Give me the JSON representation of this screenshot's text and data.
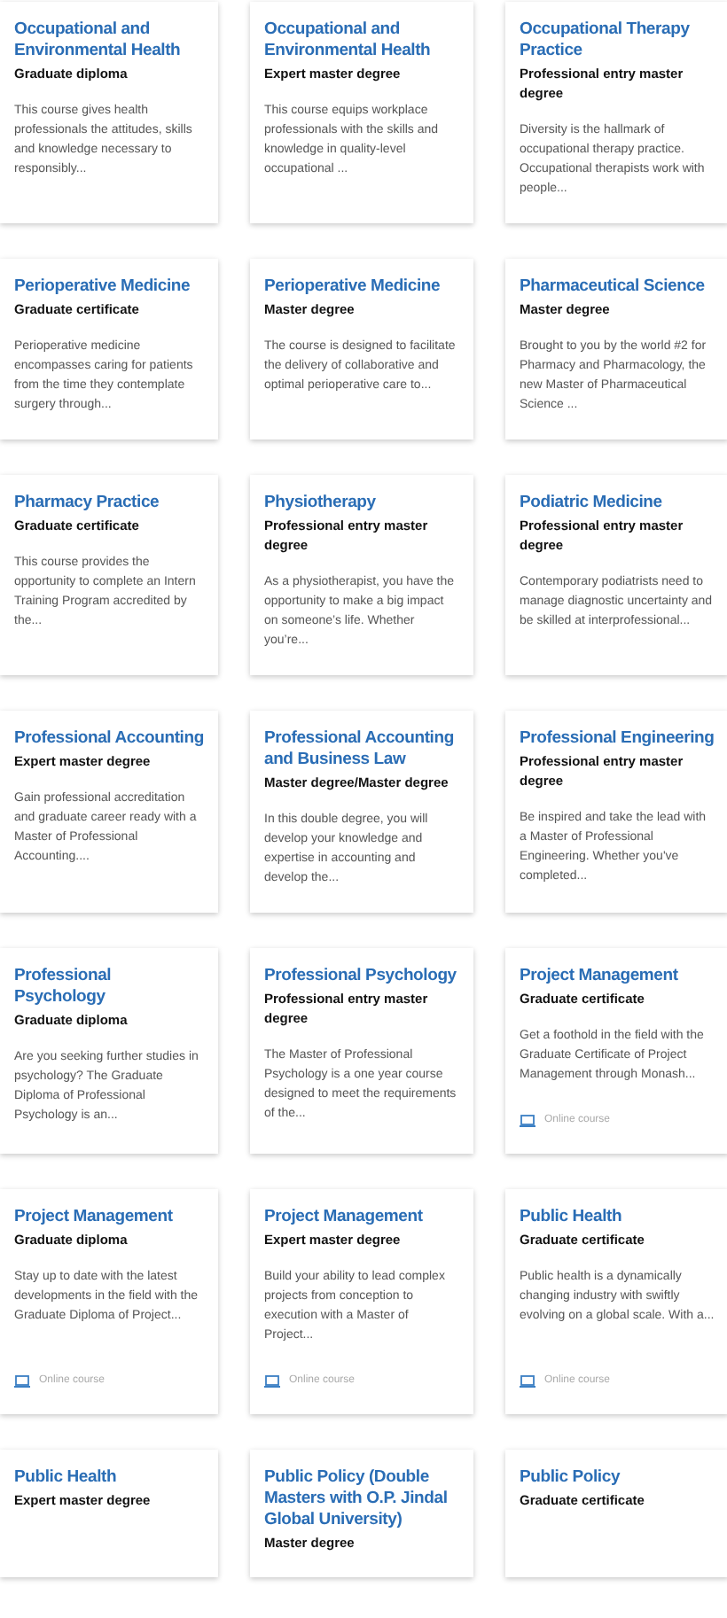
{
  "courses": [
    {
      "title": "Occupational and Environmental Health",
      "degree": "Graduate diploma",
      "description": "This course gives health professionals the attitudes, skills and knowledge necessary to responsibly..."
    },
    {
      "title": "Occupational and Environmental Health",
      "degree": "Expert master degree",
      "description": "This course equips workplace professionals with the skills and knowledge in quality-level occupational ..."
    },
    {
      "title": "Occupational Therapy Practice",
      "degree": "Professional entry master degree",
      "description": "Diversity is the hallmark of occupational therapy practice. Occupational therapists work with people..."
    },
    {
      "title": "Perioperative Medicine",
      "degree": "Graduate certificate",
      "description": "Perioperative medicine encompasses caring for patients from the time they contemplate surgery through..."
    },
    {
      "title": "Perioperative Medicine",
      "degree": "Master degree",
      "description": "The course is designed to facilitate the delivery of collaborative and optimal perioperative care to..."
    },
    {
      "title": "Pharmaceutical Science",
      "degree": "Master degree",
      "description": "Brought to you by the world #2 for Pharmacy and Pharmacology, the new Master of Pharmaceutical Science ..."
    },
    {
      "title": "Pharmacy Practice",
      "degree": "Graduate certificate",
      "description": "This course provides the opportunity to complete an Intern Training Program accredited by the..."
    },
    {
      "title": "Physiotherapy",
      "degree": "Professional entry master degree",
      "description": "As a physiotherapist, you have the opportunity to make a big impact on someone’s life. Whether you’re..."
    },
    {
      "title": "Podiatric Medicine",
      "degree": "Professional entry master degree",
      "description": "Contemporary podiatrists need to manage diagnostic uncertainty and be skilled at interprofessional..."
    },
    {
      "title": "Professional Accounting",
      "degree": "Expert master degree",
      "description": "Gain professional accreditation and graduate career ready with a Master of Professional Accounting...."
    },
    {
      "title": "Professional Accounting and Business Law",
      "degree": "Master degree/Master degree",
      "description": "In this double degree, you will develop your knowledge and expertise in accounting and develop the..."
    },
    {
      "title": "Professional Engineering",
      "degree": "Professional entry master degree",
      "description": "Be inspired and take the lead with a Master of Professional Engineering. Whether you've completed..."
    },
    {
      "title": "Professional Psychology",
      "degree": "Graduate diploma",
      "description": "Are you seeking further studies in psychology? The Graduate Diploma of Professional Psychology is an..."
    },
    {
      "title": "Professional Psychology",
      "degree": "Professional entry master degree",
      "description": "The Master of Professional Psychology is a one year course designed to meet the requirements of the..."
    },
    {
      "title": "Project Management",
      "degree": "Graduate certificate",
      "description": "Get a foothold in the field with the Graduate Certificate of Project Management through Monash...",
      "delivery": "Online course"
    },
    {
      "title": "Project Management",
      "degree": "Graduate diploma",
      "description": "Stay up to date with the latest developments in the field with the Graduate Diploma of Project...",
      "delivery": "Online course"
    },
    {
      "title": "Project Management",
      "degree": "Expert master degree",
      "description": "Build your ability to lead complex projects from conception to execution with a Master of Project...",
      "delivery": "Online course"
    },
    {
      "title": "Public Health",
      "degree": "Graduate certificate",
      "description": "Public health is a dynamically changing industry with swiftly evolving on a global scale. With a...",
      "delivery": "Online course"
    },
    {
      "title": "Public Health",
      "degree": "Expert master degree"
    },
    {
      "title": "Public Policy (Double Masters with O.P. Jindal Global University)",
      "degree": "Master degree"
    },
    {
      "title": "Public Policy",
      "degree": "Graduate certificate"
    }
  ]
}
